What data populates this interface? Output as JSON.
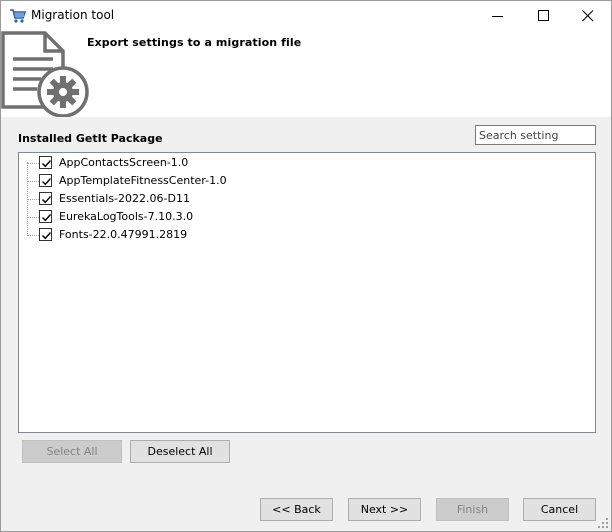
{
  "window": {
    "title": "Migration tool",
    "icon": "cart-icon"
  },
  "header": {
    "title": "Export settings to a migration file",
    "icon": "document-gear-icon"
  },
  "section": {
    "label": "Installed GetIt Package"
  },
  "search": {
    "placeholder": "Search setting",
    "value": ""
  },
  "packages": [
    {
      "label": "AppContactsScreen-1.0",
      "checked": true
    },
    {
      "label": "AppTemplateFitnessCenter-1.0",
      "checked": true
    },
    {
      "label": "Essentials-2022.06-D11",
      "checked": true
    },
    {
      "label": "EurekaLogTools-7.10.3.0",
      "checked": true
    },
    {
      "label": "Fonts-22.0.47991.2819",
      "checked": true
    }
  ],
  "buttons": {
    "select_all": "Select All",
    "deselect_all": "Deselect All",
    "back": "<< Back",
    "next": "Next >>",
    "finish": "Finish",
    "cancel": "Cancel"
  },
  "colors": {
    "check": "#000000",
    "header_bg": "#ffffff",
    "body_bg": "#f0f0f0"
  }
}
